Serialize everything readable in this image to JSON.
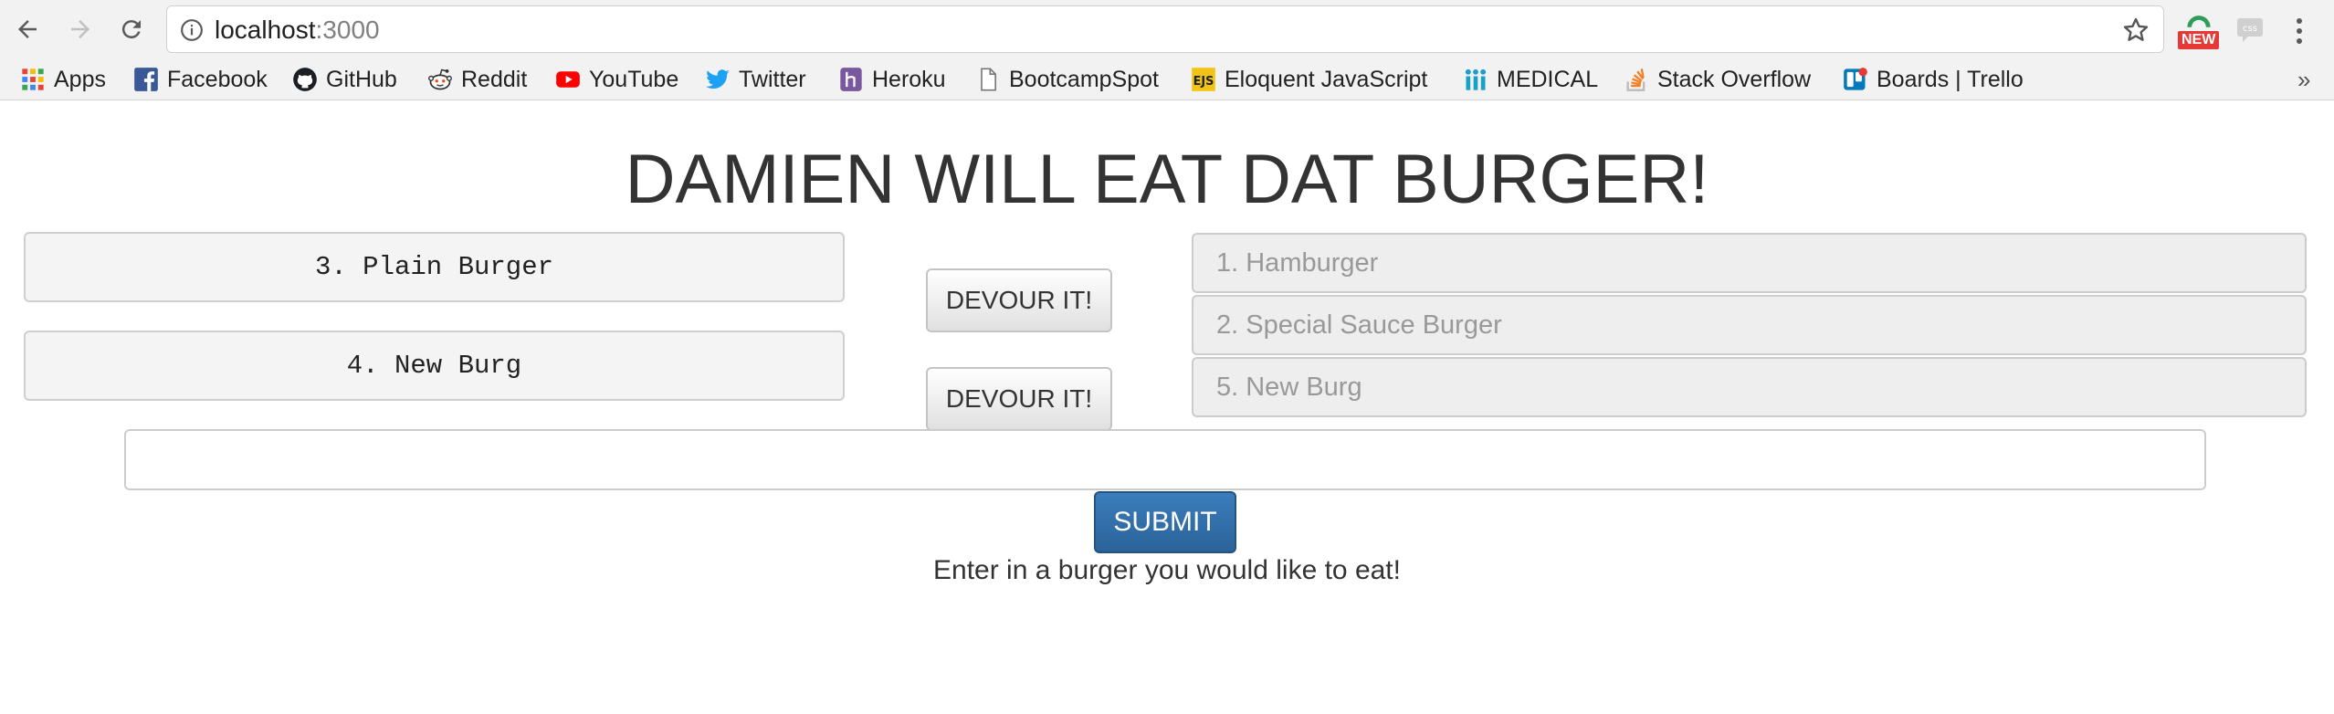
{
  "browser": {
    "url_host": "localhost",
    "url_port": ":3000",
    "extension_badge": "NEW",
    "bookmarks": [
      {
        "label": "Apps",
        "icon": "apps-grid-icon"
      },
      {
        "label": "Facebook",
        "icon": "facebook-icon"
      },
      {
        "label": "GitHub",
        "icon": "github-icon"
      },
      {
        "label": "Reddit",
        "icon": "reddit-icon"
      },
      {
        "label": "YouTube",
        "icon": "youtube-icon"
      },
      {
        "label": "Twitter",
        "icon": "twitter-icon"
      },
      {
        "label": "Heroku",
        "icon": "heroku-icon"
      },
      {
        "label": "BootcampSpot",
        "icon": "page-icon"
      },
      {
        "label": "Eloquent JavaScript",
        "icon": "ejs-icon"
      },
      {
        "label": "MEDICAL",
        "icon": "medical-icon"
      },
      {
        "label": "Stack Overflow",
        "icon": "stackoverflow-icon"
      },
      {
        "label": "Boards | Trello",
        "icon": "trello-icon"
      }
    ],
    "more": "»"
  },
  "page": {
    "title": "DAMIEN WILL EAT DAT BURGER!",
    "uneaten": [
      "3. Plain Burger",
      "4. New Burg"
    ],
    "devour_label": "DEVOUR IT!",
    "devoured": [
      "1. Hamburger",
      "2. Special Sauce Burger",
      "5. New Burg"
    ],
    "input_value": "",
    "submit_label": "SUBMIT",
    "help_text": "Enter in a burger you would like to eat!"
  },
  "colors": {
    "submit_bg": "#2b6299",
    "devoured_text": "#999999",
    "title_text": "#333333"
  }
}
